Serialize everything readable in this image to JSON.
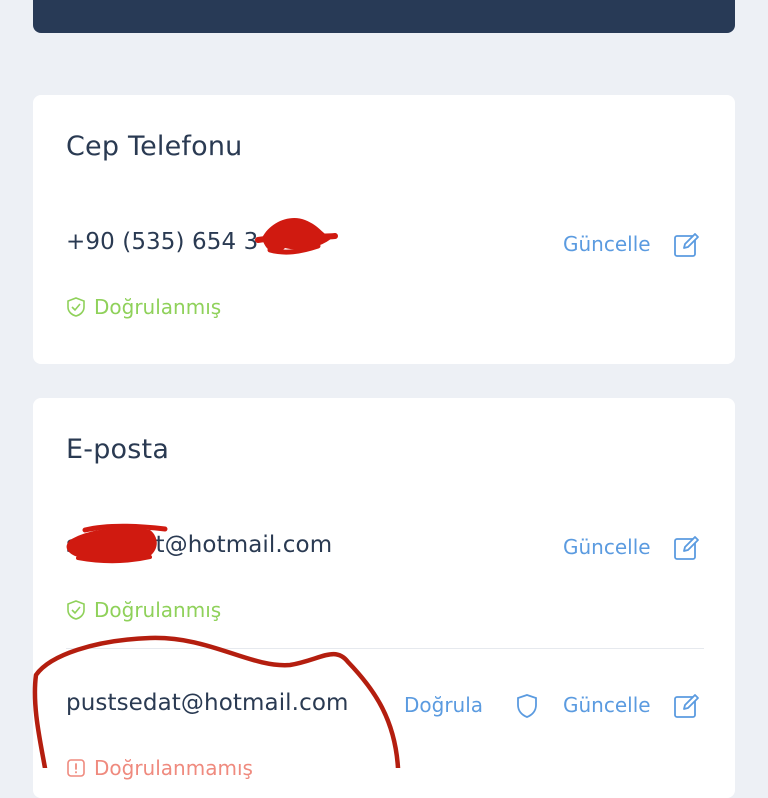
{
  "phone_section": {
    "title": "Cep Telefonu",
    "number": "+90 (535) 654 3",
    "update_label": "Güncelle",
    "status": "Doğrulanmış"
  },
  "email_section": {
    "title": "E-posta",
    "primary": {
      "address": "s  azimut@hotmail.com",
      "update_label": "Güncelle",
      "status": "Doğrulanmış"
    },
    "secondary": {
      "address": "pustsedat@hotmail.com",
      "verify_label": "Doğrula",
      "update_label": "Güncelle",
      "status": "Doğrulanmamış"
    }
  },
  "colors": {
    "header": "#283a56",
    "background": "#edf0f5",
    "link": "#5b9be0",
    "verified": "#8fd15a",
    "unverified": "#ef8a7e",
    "annotation": "#b41e0f"
  },
  "icons": [
    "edit-icon",
    "shield-check-icon",
    "shield-icon",
    "alert-icon"
  ]
}
